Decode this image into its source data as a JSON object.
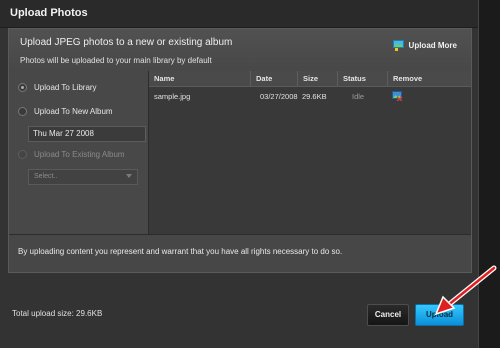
{
  "dialog": {
    "title": "Upload Photos"
  },
  "panel": {
    "heading": "Upload JPEG photos to a new or existing album",
    "subheading": "Photos will be uploaded to your main library by default",
    "upload_more_label": "Upload More",
    "upload_more_icon": "add-photo-icon"
  },
  "options": {
    "upload_to_library": "Upload To Library",
    "upload_to_new_album": "Upload To New Album",
    "new_album_name": "Thu Mar 27 2008",
    "upload_to_existing_album": "Upload To Existing Album",
    "existing_album_selected": "Select..",
    "selected_option": "upload_to_library"
  },
  "table": {
    "columns": [
      "Name",
      "Date",
      "Size",
      "Status",
      "Remove"
    ],
    "rows": [
      {
        "name": "sample.jpg",
        "date": "03/27/2008",
        "size": "29.6KB",
        "status": "Idle",
        "remove_icon": "remove-icon"
      }
    ]
  },
  "footer": {
    "disclaimer": "By uploading content you represent and warrant that you have all rights necessary to do so.",
    "total_upload_size": "Total upload size: 29.6KB",
    "cancel_label": "Cancel",
    "upload_label": "Upload"
  },
  "colors": {
    "accent": "#1aa8ee",
    "annotation_arrow": "#e02020",
    "background": "#333333"
  }
}
